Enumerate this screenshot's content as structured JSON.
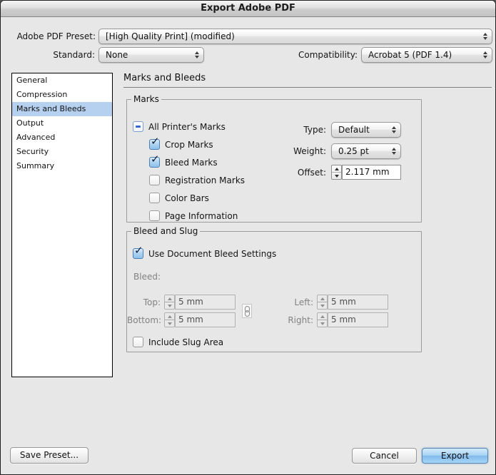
{
  "window": {
    "title": "Export Adobe PDF"
  },
  "preset_row": {
    "label": "Adobe PDF Preset:",
    "value": "[High Quality Print] (modified)"
  },
  "standard_row": {
    "label": "Standard:",
    "value": "None"
  },
  "compatibility_row": {
    "label": "Compatibility:",
    "value": "Acrobat 5 (PDF 1.4)"
  },
  "sidebar": {
    "items": [
      {
        "label": "General",
        "selected": false
      },
      {
        "label": "Compression",
        "selected": false
      },
      {
        "label": "Marks and Bleeds",
        "selected": true
      },
      {
        "label": "Output",
        "selected": false
      },
      {
        "label": "Advanced",
        "selected": false
      },
      {
        "label": "Security",
        "selected": false
      },
      {
        "label": "Summary",
        "selected": false
      }
    ]
  },
  "main": {
    "header": "Marks and Bleeds",
    "marks_group": {
      "legend": "Marks",
      "all_printers_marks": {
        "label": "All Printer's Marks",
        "state": "mixed"
      },
      "checkboxes": [
        {
          "label": "Crop Marks",
          "checked": true
        },
        {
          "label": "Bleed Marks",
          "checked": true
        },
        {
          "label": "Registration Marks",
          "checked": false
        },
        {
          "label": "Color Bars",
          "checked": false
        },
        {
          "label": "Page Information",
          "checked": false
        }
      ],
      "type": {
        "label": "Type:",
        "value": "Default"
      },
      "weight": {
        "label": "Weight:",
        "value": "0.25 pt"
      },
      "offset": {
        "label": "Offset:",
        "value": "2.117 mm"
      }
    },
    "bleed_group": {
      "legend": "Bleed and Slug",
      "use_document_bleed": {
        "label": "Use Document Bleed Settings",
        "checked": true
      },
      "bleed_label": "Bleed:",
      "fields": {
        "top": {
          "label": "Top:",
          "value": "5 mm"
        },
        "bottom": {
          "label": "Bottom:",
          "value": "5 mm"
        },
        "left": {
          "label": "Left:",
          "value": "5 mm"
        },
        "right": {
          "label": "Right:",
          "value": "5 mm"
        }
      },
      "include_slug": {
        "label": "Include Slug Area",
        "checked": false
      }
    }
  },
  "footer": {
    "save_preset": "Save Preset...",
    "cancel": "Cancel",
    "export": "Export"
  },
  "colors": {
    "dialog_background": "#e7e7e7",
    "selection_highlight": "#b6d1ef",
    "checkbox_blue": "#8fc1ea",
    "export_button_blue": "#83baec"
  }
}
